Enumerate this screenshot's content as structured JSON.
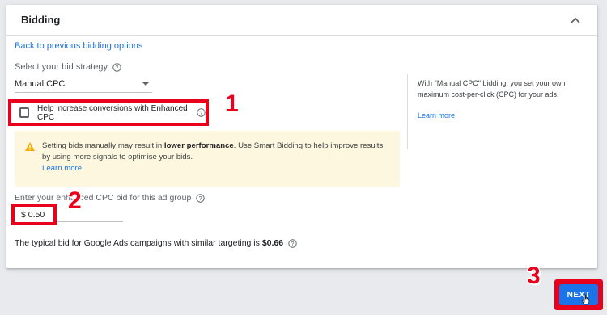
{
  "bidding": {
    "title": "Bidding",
    "back_link": "Back to previous bidding options",
    "strategy_label": "Select your bid strategy",
    "strategy_value": "Manual CPC",
    "side_panel": {
      "text": "With \"Manual CPC\" bidding, you set your own maximum cost-per-click (CPC) for your ads.",
      "learn_more": "Learn more"
    },
    "ecpc_checkbox_label": "Help increase conversions with Enhanced CPC",
    "ecpc_checked": false,
    "warning": {
      "text_before": "Setting bids manually may result in ",
      "text_bold": "lower performance",
      "text_after": ". Use Smart Bidding to help improve results by using more signals to optimise your bids.",
      "learn_more": "Learn more"
    },
    "bid_label": "Enter your enhanced CPC bid for this ad group",
    "bid_value": "$ 0.50",
    "typical_text": "The typical bid for Google Ads campaigns with similar targeting is ",
    "typical_value": "$0.66"
  },
  "annotations": {
    "step1": "1",
    "step2": "2",
    "step3": "3"
  },
  "footer": {
    "next_label": "NEXT"
  },
  "colors": {
    "accent": "#1a73e8",
    "highlight": "#e8001c",
    "warning_bg": "#fef7e0",
    "warning_icon": "#f9ab00"
  }
}
